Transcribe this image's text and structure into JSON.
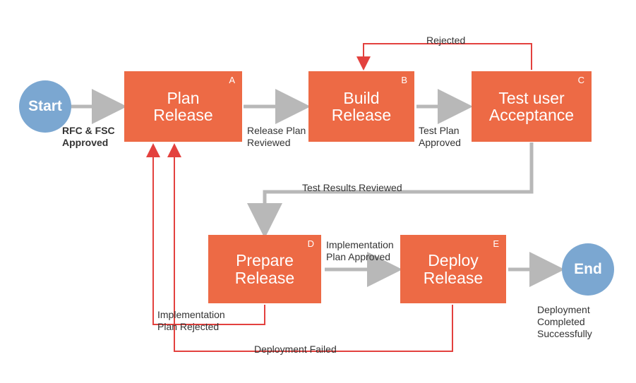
{
  "nodes": {
    "start": "Start",
    "end": "End",
    "a": {
      "tag": "A",
      "label": "Plan\nRelease"
    },
    "b": {
      "tag": "B",
      "label": "Build\nRelease"
    },
    "c": {
      "tag": "C",
      "label": "Test user\nAcceptance"
    },
    "d": {
      "tag": "D",
      "label": "Prepare\nRelease"
    },
    "e": {
      "tag": "E",
      "label": "Deploy\nRelease"
    }
  },
  "labels": {
    "start_a": "RFC & FSC\nApproved",
    "a_b": "Release Plan\nReviewed",
    "b_c": "Test Plan\nApproved",
    "c_b_reject": "Rejected",
    "c_d": "Test Results Reviewed",
    "d_e": "Implementation\nPlan Approved",
    "e_end": "Deployment\nCompleted\nSuccessfully",
    "d_a_reject": "Implementation\nPlan Rejected",
    "e_a_reject": "Deployment Failed"
  }
}
